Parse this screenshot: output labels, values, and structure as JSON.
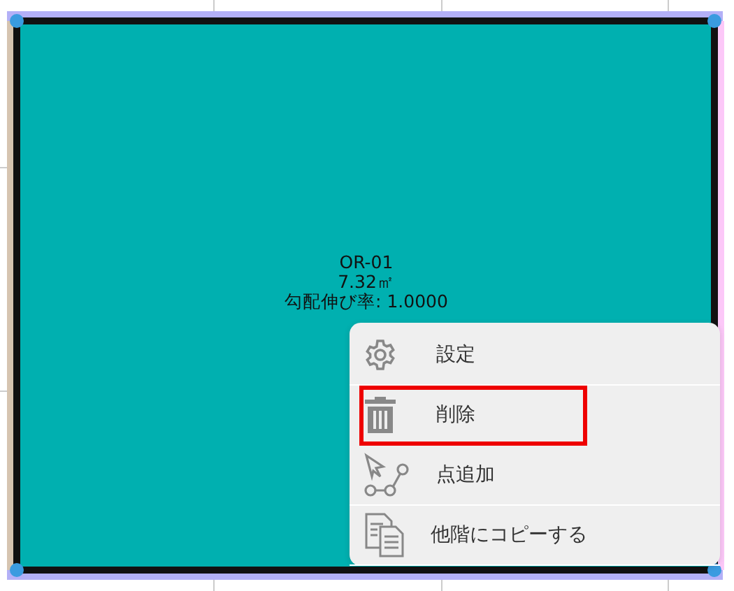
{
  "room": {
    "name": "OR-01",
    "area": "7.32㎡",
    "slope_ratio": "勾配伸び率: 1.0000"
  },
  "context_menu": {
    "items": [
      {
        "kind": "settings",
        "label": "設定",
        "selected": false
      },
      {
        "kind": "delete",
        "label": "削除",
        "selected": true
      },
      {
        "kind": "add-point",
        "label": "点追加",
        "selected": false
      },
      {
        "kind": "copy",
        "label": "他階にコピーする",
        "selected": false
      }
    ]
  }
}
